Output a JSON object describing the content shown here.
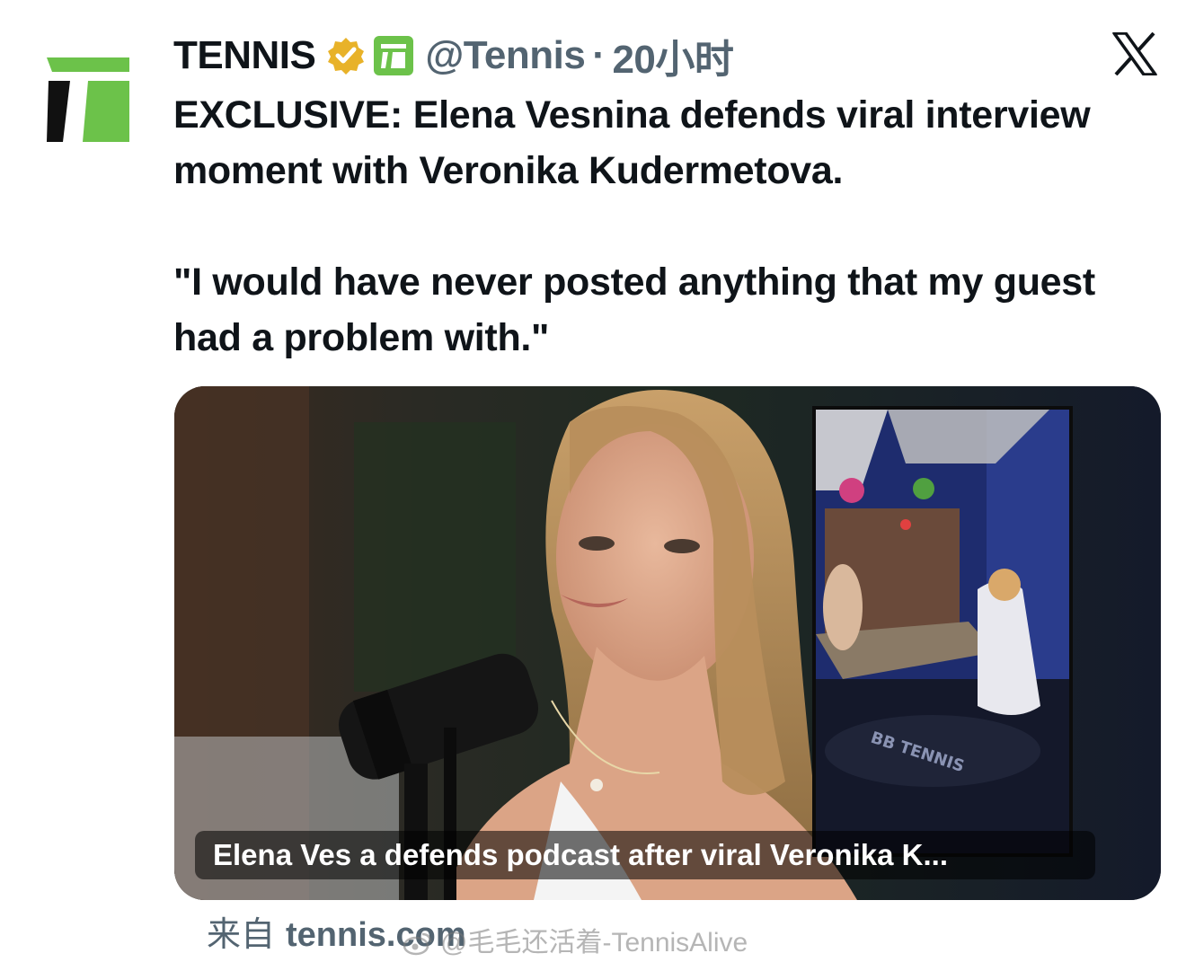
{
  "tweet": {
    "display_name": "TENNIS",
    "handle": "@Tennis",
    "separator": "·",
    "time": "20小时",
    "text_paragraphs": [
      "EXCLUSIVE: Elena Vesnina defends viral interview moment with Veronika Kudermetova.",
      "\"I would have never posted anything that my guest had a problem with.\""
    ],
    "card_caption": "Elena Ves  a defends podcast after viral Veronika K...",
    "source_prefix": "来自",
    "source_domain": "tennis.com"
  },
  "watermark": {
    "text": "@毛毛还活着-TennisAlive"
  },
  "inset": {
    "floor_logo_text": "BB TENNIS"
  },
  "icons": {
    "avatar": "tennis-channel-logo",
    "verified": "gold-verified-badge-icon",
    "affiliate": "tennis-affiliate-badge-icon",
    "platform": "x-logo-icon"
  },
  "colors": {
    "brand_green": "#6cc24a",
    "verified_gold": "#e8b229",
    "text_primary": "#0f1419",
    "text_secondary": "#536471"
  }
}
